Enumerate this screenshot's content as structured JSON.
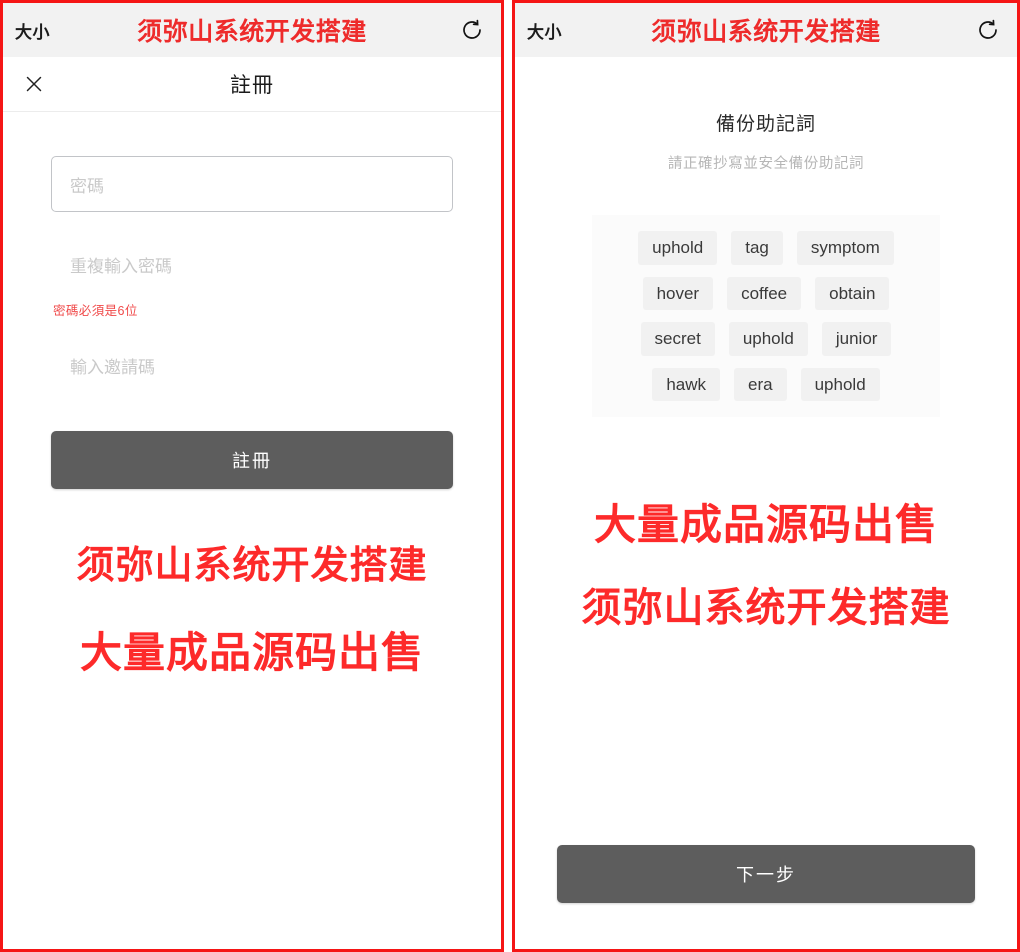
{
  "browser_chrome": {
    "size_label": "大小",
    "title": "须弥山系统开发搭建",
    "refresh_icon": "refresh-icon"
  },
  "left_panel": {
    "navbar": {
      "close_icon": "close-icon",
      "title": "註冊"
    },
    "form": {
      "password_placeholder": "密碼",
      "confirm_password_placeholder": "重複輸入密碼",
      "error_message": "密碼必須是6位",
      "invite_code_placeholder": "輸入邀請碼",
      "submit_label": "註冊"
    },
    "watermark": {
      "line1": "须弥山系统开发搭建",
      "line2": "大量成品源码出售"
    }
  },
  "right_panel": {
    "mnemonic": {
      "title": "備份助記詞",
      "subtitle": "請正確抄寫並安全備份助記詞",
      "words": [
        "uphold",
        "tag",
        "symptom",
        "hover",
        "coffee",
        "obtain",
        "secret",
        "uphold",
        "junior",
        "hawk",
        "era",
        "uphold"
      ]
    },
    "watermark": {
      "line1": "大量成品源码出售",
      "line2": "须弥山系统开发搭建"
    },
    "next_button_label": "下一步"
  },
  "colors": {
    "frame_red": "#f51515",
    "watermark_red": "#fd2a2a",
    "title_red": "#ee2b2b",
    "button_gray": "#5d5d5d",
    "error_red": "#f04a4a",
    "chip_bg": "#f1f1f1"
  }
}
